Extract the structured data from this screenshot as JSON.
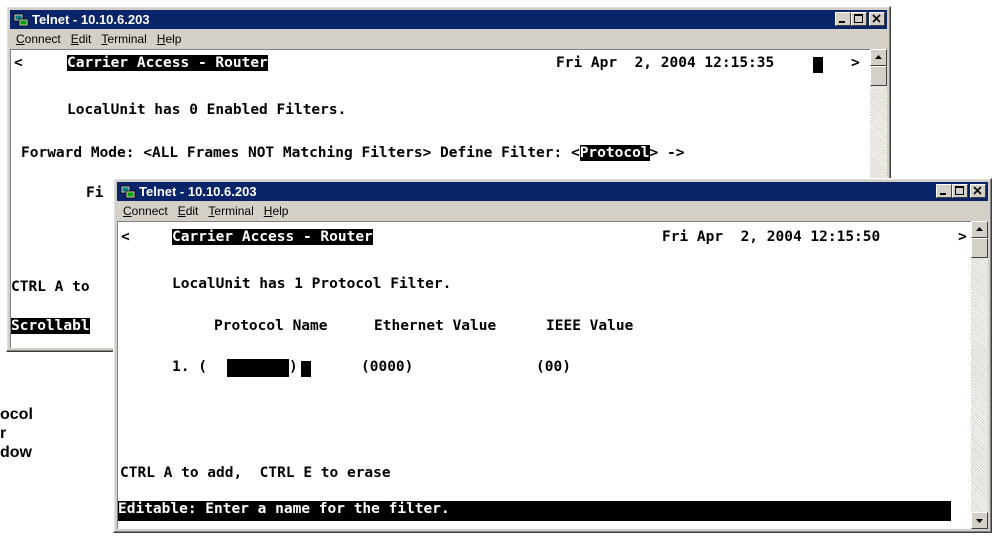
{
  "side_label": {
    "line1": "ocol",
    "line2": "r",
    "line3": "dow"
  },
  "back_window": {
    "title": "Telnet - 10.10.6.203",
    "menu": [
      "Connect",
      "Edit",
      "Terminal",
      "Help"
    ],
    "terminal": {
      "left_arrow": "<",
      "app_name": "Carrier Access - Router",
      "timestamp": "Fri Apr  2, 2004 12:15:35",
      "right_arrow": ">",
      "status_line": "LocalUnit has 0 Enabled Filters.",
      "forward_mode_label": "Forward Mode: <ALL Frames NOT Matching Filters> Define Filter: <",
      "define_filter_value": "Protocol",
      "forward_mode_suffix": "> ->",
      "partial_line": "Fi",
      "ctrl_partial": "CTRL A to",
      "scrollable_partial": "Scrollabl"
    }
  },
  "front_window": {
    "title": "Telnet - 10.10.6.203",
    "menu": [
      "Connect",
      "Edit",
      "Terminal",
      "Help"
    ],
    "terminal": {
      "left_arrow": "<",
      "app_name": "Carrier Access - Router",
      "timestamp": "Fri Apr  2, 2004 12:15:50",
      "right_arrow": ">",
      "status_line": "LocalUnit has 1 Protocol Filter.",
      "headers": {
        "protocol_name": "Protocol Name",
        "ethernet_value": "Ethernet Value",
        "ieee_value": "IEEE Value"
      },
      "row": {
        "index": "1. (",
        "name": "",
        "close": ")",
        "ethernet": "(0000)",
        "ieee": "(00)"
      },
      "help_line": "CTRL A to add,  CTRL E to erase",
      "status_bar": "Editable: Enter a name for the filter."
    }
  }
}
